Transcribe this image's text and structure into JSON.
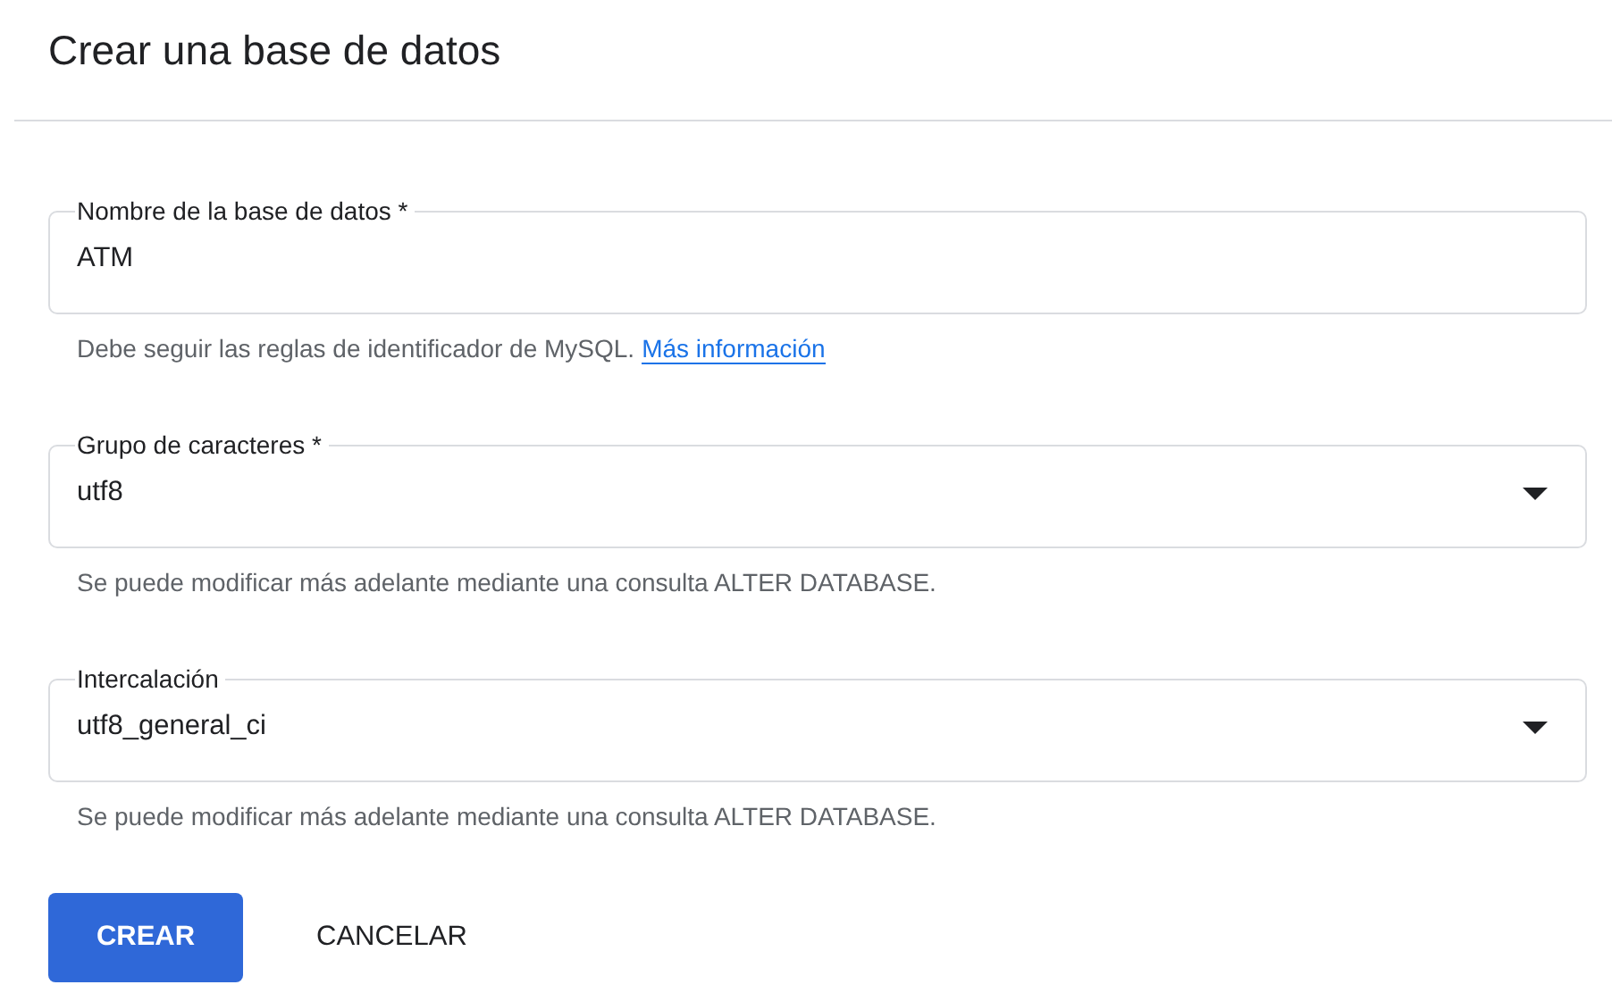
{
  "title": "Crear una base de datos",
  "fields": [
    {
      "kind": "text",
      "label": "Nombre de la base de datos *",
      "value": "ATM",
      "helper": "Debe seguir las reglas de identificador de MySQL.",
      "link": "Más información"
    },
    {
      "kind": "select",
      "label": "Grupo de caracteres *",
      "value": "utf8",
      "helper": "Se puede modificar más adelante mediante una consulta ALTER DATABASE."
    },
    {
      "kind": "select",
      "label": "Intercalación",
      "value": "utf8_general_ci",
      "helper": "Se puede modificar más adelante mediante una consulta ALTER DATABASE."
    }
  ],
  "buttons": [
    {
      "kind": "primary",
      "label": "CREAR"
    },
    {
      "kind": "text",
      "label": "CANCELAR"
    }
  ]
}
